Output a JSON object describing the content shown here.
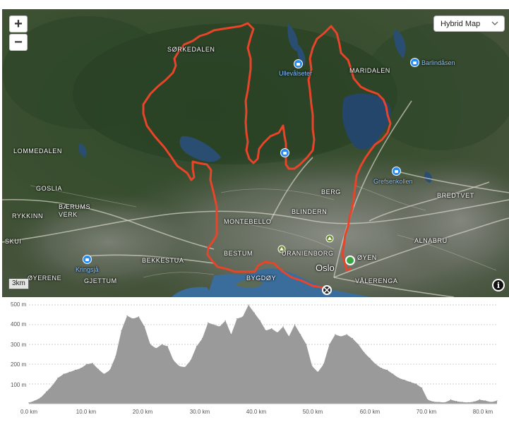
{
  "map": {
    "map_type_label": "Hybrid Map",
    "scale_label": "3km",
    "zoom_in_label": "+",
    "zoom_out_label": "−",
    "info_label": "i",
    "places": [
      {
        "id": "sorkedalen",
        "label": "SØRKEDALEN"
      },
      {
        "id": "maridalen",
        "label": "MARIDALEN"
      },
      {
        "id": "lommedalen",
        "label": "LOMMEDALEN"
      },
      {
        "id": "goslia",
        "label": "GOSLIA"
      },
      {
        "id": "baerums-verk",
        "label": "BÆRUMS VERK"
      },
      {
        "id": "berg",
        "label": "BERG"
      },
      {
        "id": "blindern",
        "label": "BLINDERN"
      },
      {
        "id": "bredtvet",
        "label": "BREDTVET"
      },
      {
        "id": "montebello",
        "label": "MONTEBELLO"
      },
      {
        "id": "rykkinn",
        "label": "RYKKINN"
      },
      {
        "id": "skui",
        "label": "SKUI"
      },
      {
        "id": "alnabru",
        "label": "ALNABRU"
      },
      {
        "id": "bestum",
        "label": "BESTUM"
      },
      {
        "id": "uranienborg",
        "label": "URANIENBORG"
      },
      {
        "id": "bekkestua",
        "label": "BEKKESTUA"
      },
      {
        "id": "oyen",
        "label": "ØYEN"
      },
      {
        "id": "oslo",
        "label": "Oslo"
      },
      {
        "id": "gjettum",
        "label": "GJETTUM"
      },
      {
        "id": "bygdoy",
        "label": "BYGDØY"
      },
      {
        "id": "valerenga",
        "label": "VÅLERENGA"
      },
      {
        "id": "oyeren",
        "label": "ØYERENE"
      }
    ],
    "pois": [
      {
        "id": "ullevalseter",
        "label": "Ullevålseter"
      },
      {
        "id": "barlindasen",
        "label": "Barlindåsen"
      },
      {
        "id": "grefsenkollen",
        "label": "Grefsenkollen"
      },
      {
        "id": "kringsja",
        "label": "Kringsjå"
      },
      {
        "id": "unnamed-1",
        "label": ""
      },
      {
        "id": "unnamed-2",
        "label": ""
      }
    ],
    "route_color": "#e8442a"
  },
  "profile": {
    "y_labels": [
      "500 m",
      "400 m",
      "300 m",
      "200 m",
      "100 m"
    ],
    "x_labels": [
      "0.0 km",
      "10.0 km",
      "20.0 km",
      "30.0 km",
      "40.0 km",
      "50.0 km",
      "60.0 km",
      "70.0 km",
      "80.0 km"
    ]
  },
  "chart_data": {
    "type": "area",
    "xlabel": "",
    "ylabel": "",
    "xlim": [
      0,
      81
    ],
    "ylim": [
      0,
      500
    ],
    "x_unit": "km",
    "y_unit": "m",
    "grid": true,
    "fill_color": "#9a9a9a",
    "x": [
      0,
      1,
      2,
      3,
      4,
      5,
      6,
      7,
      8,
      9,
      10,
      11,
      12,
      13,
      14,
      15,
      16,
      17,
      18,
      19,
      20,
      21,
      22,
      23,
      24,
      25,
      26,
      27,
      28,
      29,
      30,
      31,
      32,
      33,
      34,
      35,
      36,
      37,
      38,
      39,
      40,
      41,
      42,
      43,
      44,
      45,
      46,
      47,
      48,
      49,
      50,
      51,
      52,
      53,
      54,
      55,
      56,
      57,
      58,
      59,
      60,
      61,
      62,
      63,
      64,
      65,
      66,
      67,
      68,
      69,
      70,
      71,
      72,
      73,
      74,
      75,
      76,
      77,
      78,
      79,
      80,
      81
    ],
    "values": [
      5,
      15,
      30,
      60,
      90,
      130,
      150,
      160,
      170,
      180,
      200,
      205,
      175,
      150,
      170,
      240,
      370,
      445,
      430,
      440,
      390,
      300,
      280,
      300,
      290,
      220,
      190,
      185,
      220,
      290,
      330,
      410,
      400,
      390,
      420,
      350,
      430,
      440,
      500,
      460,
      420,
      370,
      380,
      360,
      390,
      340,
      400,
      350,
      300,
      190,
      160,
      200,
      300,
      350,
      340,
      350,
      330,
      300,
      260,
      230,
      200,
      180,
      170,
      150,
      130,
      120,
      110,
      100,
      80,
      20,
      10,
      8,
      6,
      20,
      12,
      8,
      6,
      10,
      20,
      15,
      8,
      15
    ]
  }
}
